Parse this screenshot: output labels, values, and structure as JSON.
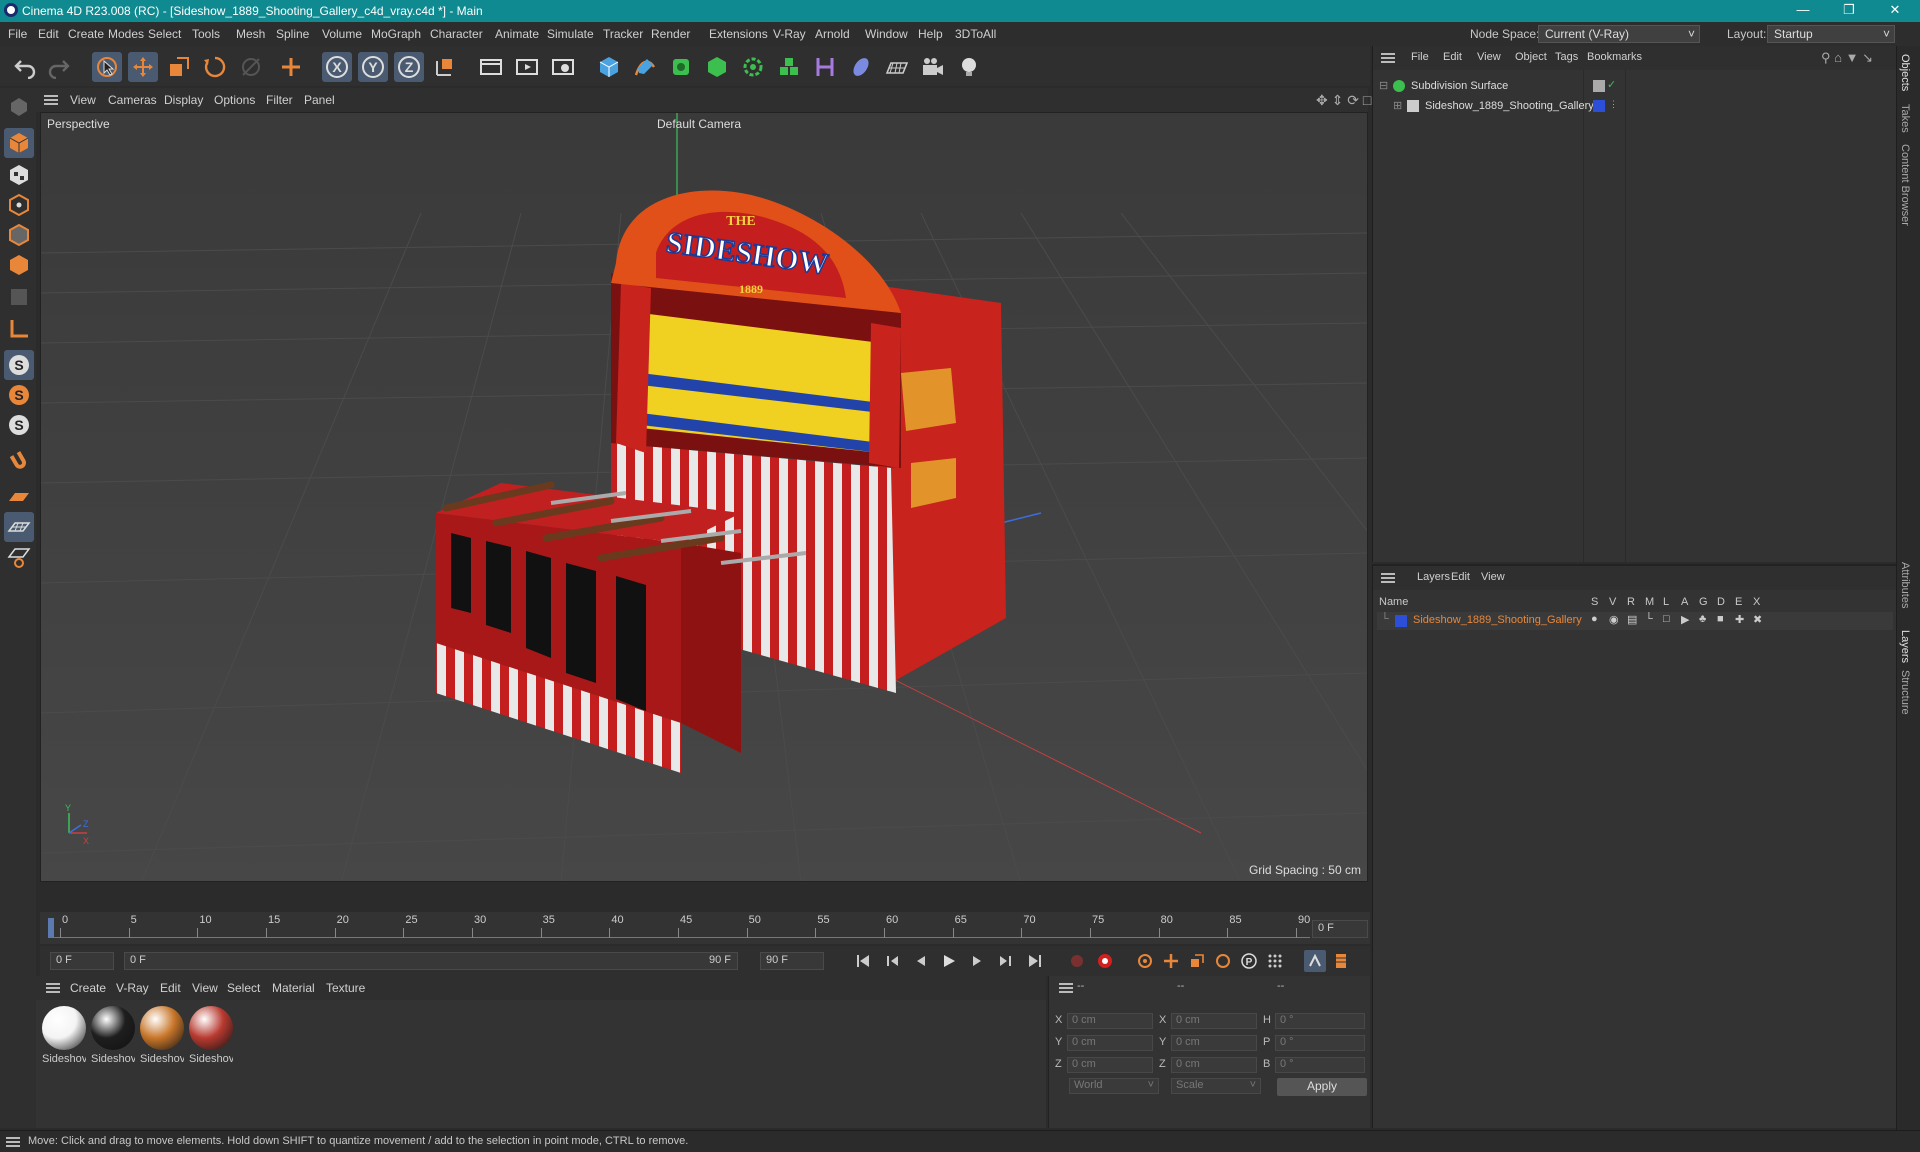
{
  "window": {
    "title": "Cinema 4D R23.008 (RC) - [Sideshow_1889_Shooting_Gallery_c4d_vray.c4d *] - Main"
  },
  "menu": [
    "File",
    "Edit",
    "Create",
    "Modes",
    "Select",
    "Tools",
    "Mesh",
    "Spline",
    "Volume",
    "MoGraph",
    "Character",
    "Animate",
    "Simulate",
    "Tracker",
    "Render",
    "Extensions",
    "V-Ray",
    "Arnold",
    "Window",
    "Help",
    "3DToAll"
  ],
  "node_space": {
    "label": "Node Space:",
    "value": "Current (V-Ray)"
  },
  "layout": {
    "label": "Layout:",
    "value": "Startup"
  },
  "viewport_menu": [
    "View",
    "Cameras",
    "Display",
    "Options",
    "Filter",
    "Panel"
  ],
  "viewport": {
    "name": "Perspective",
    "camera": "Default Camera",
    "grid_spacing": "Grid Spacing : 50 cm",
    "axis_x": "X",
    "axis_y": "Y",
    "axis_z": "Z",
    "sign_title": "THE",
    "sign_main": "SIDESHOW",
    "sign_year": "1889"
  },
  "timeline": {
    "ticks": [
      "0",
      "5",
      "10",
      "15",
      "20",
      "25",
      "30",
      "35",
      "40",
      "45",
      "50",
      "55",
      "60",
      "65",
      "70",
      "75",
      "80",
      "85",
      "90"
    ],
    "current_frame": "0 F",
    "start_frame": "0 F",
    "range_start": "0 F",
    "range_end": "90 F",
    "end_frame": "90 F"
  },
  "material_menu": [
    "Create",
    "V-Ray",
    "Edit",
    "View",
    "Select",
    "Material",
    "Texture"
  ],
  "materials": [
    {
      "label": "Sideshov",
      "color": "#f4f4f4"
    },
    {
      "label": "Sideshov",
      "color": "#1e1e1e"
    },
    {
      "label": "Sideshov",
      "color": "#c8762a"
    },
    {
      "label": "Sideshov",
      "color": "#b83a30"
    }
  ],
  "coords": {
    "header": [
      "--",
      "--",
      "--"
    ],
    "rows": [
      {
        "a": "X",
        "av": "0 cm",
        "b": "X",
        "bv": "0 cm",
        "c": "H",
        "cv": "0 °"
      },
      {
        "a": "Y",
        "av": "0 cm",
        "b": "Y",
        "bv": "0 cm",
        "c": "P",
        "cv": "0 °"
      },
      {
        "a": "Z",
        "av": "0 cm",
        "b": "Z",
        "bv": "0 cm",
        "c": "B",
        "cv": "0 °"
      }
    ],
    "space": "World",
    "mode": "Scale",
    "apply": "Apply"
  },
  "object_menu": [
    "File",
    "Edit",
    "View",
    "Object",
    "Tags",
    "Bookmarks"
  ],
  "objects": [
    {
      "name": "Subdivision Surface"
    },
    {
      "name": "Sideshow_1889_Shooting_Gallery"
    }
  ],
  "layer_menu": [
    "Layers",
    "Edit",
    "View"
  ],
  "layer_columns": {
    "name": "Name",
    "flags": [
      "S",
      "V",
      "R",
      "M",
      "L",
      "A",
      "G",
      "D",
      "E",
      "X"
    ]
  },
  "layers": [
    {
      "name": "Sideshow_1889_Shooting_Gallery",
      "color": "#2b4fd8"
    }
  ],
  "right_tabs": [
    "Objects",
    "Takes",
    "Content Browser",
    "Attributes",
    "Layers",
    "Structure"
  ],
  "status": "Move: Click and drag to move elements. Hold down SHIFT to quantize movement / add to the selection in point mode, CTRL to remove.",
  "colors": {
    "titlebar": "#0f8a90",
    "accent": "#e8873a",
    "layer_text": "#e8873a"
  }
}
